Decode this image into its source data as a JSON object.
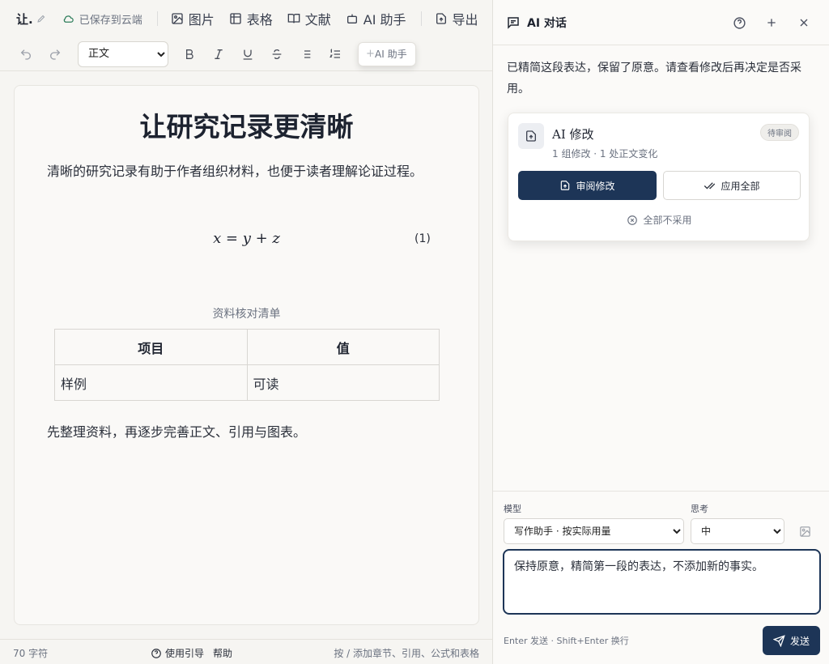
{
  "editor": {
    "doc_short": "让.",
    "cloud_status": "已保存到云端",
    "menu": {
      "image": "图片",
      "table": "表格",
      "references": "文献",
      "ai_assistant": "AI 助手",
      "export": "导出"
    },
    "toolbar": {
      "style_selected": "正文",
      "ai_chip": "AI 助手"
    },
    "document": {
      "title": "让研究记录更清晰",
      "paragraph1": "清晰的研究记录有助于作者组织材料，也便于读者理解论证过程。",
      "equation": "x = y + z",
      "equation_number": "(1)",
      "table_caption": "资料核对清单",
      "table_headers": [
        "项目",
        "值"
      ],
      "table_rows": [
        [
          "样例",
          "可读"
        ]
      ],
      "paragraph2": "先整理资料，再逐步完善正文、引用与图表。"
    },
    "status": {
      "char_count": "70 字符",
      "guide": "使用引导",
      "help": "帮助",
      "slash_hint": "按 / 添加章节、引用、公式和表格"
    }
  },
  "panel": {
    "title": "AI 对话",
    "message": "已精简这段表达，保留了原意。请查看修改后再决定是否采用。",
    "card": {
      "title": "AI 修改",
      "badge": "待审阅",
      "meta": "1 组修改 · 1 处正文变化",
      "review_label": "审阅修改",
      "apply_label": "应用全部",
      "reject_label": "全部不采用"
    },
    "composer": {
      "model_label": "模型",
      "model_selected": "写作助手 · 按实际用量",
      "think_label": "思考",
      "think_selected": "中",
      "prompt_value": "保持原意，精简第一段的表达，不添加新的事实。",
      "send_hint": "Enter 发送 · Shift+Enter 换行",
      "send_label": "发送"
    }
  },
  "colors": {
    "primary": "#1d3557",
    "cloud_green": "#2e7d5b",
    "background": "#f6f5f2"
  },
  "icons": [
    "pencil-icon",
    "cloud-icon",
    "image-icon",
    "table-icon",
    "book-icon",
    "bot-icon",
    "export-icon",
    "undo-icon",
    "redo-icon",
    "bold-icon",
    "italic-icon",
    "underline-icon",
    "strikethrough-icon",
    "bullet-list-icon",
    "numbered-list-icon",
    "chat-icon",
    "help-icon",
    "plus-icon",
    "close-icon",
    "document-icon",
    "check-double-icon",
    "x-circle-icon",
    "image-add-icon",
    "send-icon",
    "question-circle-icon"
  ]
}
